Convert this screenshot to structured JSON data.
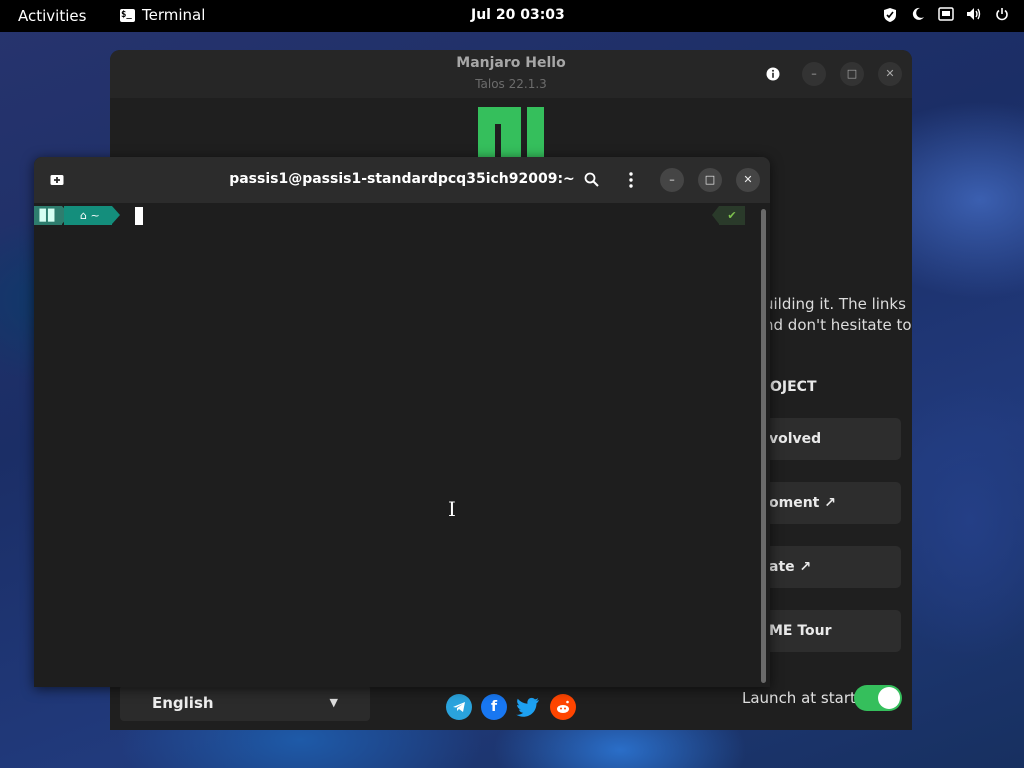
{
  "topbar": {
    "activities": "Activities",
    "app_name": "Terminal",
    "app_icon": "terminal-icon",
    "clock": "Jul 20  03:03",
    "tray_icons": [
      "shield-icon",
      "night-light-icon",
      "network-icon",
      "volume-icon",
      "power-icon"
    ]
  },
  "hello": {
    "title": "Manjaro Hello",
    "subtitle": "Talos 22.1.3",
    "desc_line1": "uilding it. The links",
    "desc_line2": "nd don't hesitate to",
    "section": "OJECT",
    "buttons": [
      "volved",
      "oment ↗",
      "ate ↗",
      "ME Tour"
    ],
    "language": "English",
    "launch_label": "Launch at start",
    "launch_enabled": true,
    "brand_color": "#35bf5c"
  },
  "terminal": {
    "title": "passis1@passis1-standardpcq35ich92009:~",
    "prompt_segment1": "▊▊",
    "prompt_segment2": "⌂ ~",
    "status": "✔"
  }
}
